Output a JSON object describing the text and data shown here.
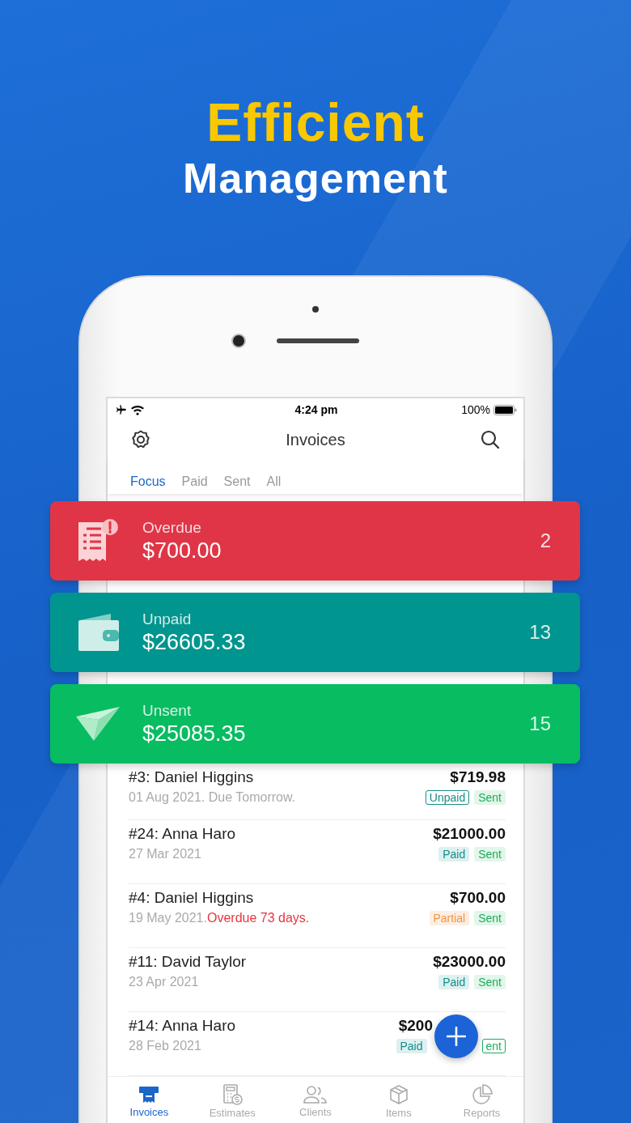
{
  "headline": {
    "line_1": "Efficient",
    "line_2": "Management"
  },
  "status_bar": {
    "time": "4:24 pm",
    "battery": "100%"
  },
  "header": {
    "title": "Invoices"
  },
  "tabs": [
    {
      "label": "Focus",
      "selected": true
    },
    {
      "label": "Paid",
      "selected": false
    },
    {
      "label": "Sent",
      "selected": false
    },
    {
      "label": "All",
      "selected": false
    }
  ],
  "summary_cards": [
    {
      "kind": "overdue",
      "label": "Overdue",
      "amount": "$700.00",
      "count": "2",
      "color": "#e03546"
    },
    {
      "kind": "unpaid",
      "label": "Unpaid",
      "amount": "$26605.33",
      "count": "13",
      "color": "#00958e"
    },
    {
      "kind": "unsent",
      "label": "Unsent",
      "amount": "$25085.35",
      "count": "15",
      "color": "#08bc62"
    }
  ],
  "invoices": [
    {
      "title": "#3: Daniel Higgins",
      "date": "01 Aug 2021. Due Tomorrow.",
      "amount": "$719.98",
      "badges": [
        {
          "kind": "unpaid",
          "label": "Unpaid"
        },
        {
          "kind": "sent",
          "label": "Sent"
        }
      ]
    },
    {
      "title": "#24: Anna Haro",
      "date": "27 Mar 2021",
      "amount": "$21000.00",
      "badges": [
        {
          "kind": "paid",
          "label": "Paid"
        },
        {
          "kind": "sent",
          "label": "Sent"
        }
      ]
    },
    {
      "title": "#4: Daniel Higgins",
      "date": "19 May 2021.",
      "alert": "Overdue 73 days.",
      "amount": "$700.00",
      "badges": [
        {
          "kind": "partial",
          "label": "Partial"
        },
        {
          "kind": "sent",
          "label": "Sent"
        }
      ]
    },
    {
      "title": "#11: David Taylor",
      "date": "23 Apr 2021",
      "amount": "$23000.00",
      "badges": [
        {
          "kind": "paid",
          "label": "Paid"
        },
        {
          "kind": "sent",
          "label": "Sent"
        }
      ]
    },
    {
      "title": "#14: Anna Haro",
      "date": "28 Feb 2021",
      "amount": "$200",
      "badges": [
        {
          "kind": "paid",
          "label": "Paid"
        },
        {
          "kind": "unsent",
          "label": "ent"
        }
      ],
      "under_add_button": true
    }
  ],
  "bottom_nav": [
    {
      "kind": "invoices",
      "label": "Invoices",
      "selected": true
    },
    {
      "kind": "estimates",
      "label": "Estimates",
      "selected": false
    },
    {
      "kind": "clients",
      "label": "Clients",
      "selected": false
    },
    {
      "kind": "items",
      "label": "Items",
      "selected": false
    },
    {
      "kind": "reports",
      "label": "Reports",
      "selected": false
    }
  ]
}
